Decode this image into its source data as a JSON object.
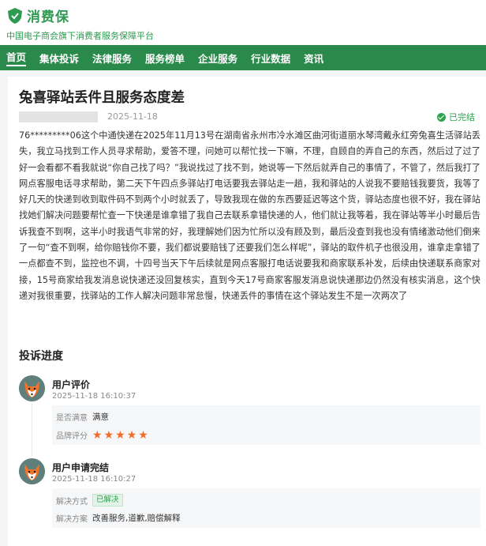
{
  "brand": {
    "name": "消费保",
    "slogan": "中国电子商会旗下消费者服务保障平台",
    "color": "#2e9a52"
  },
  "nav": {
    "items": [
      "首页",
      "集体投诉",
      "法律服务",
      "服务榜单",
      "企业服务",
      "行业数据",
      "资讯"
    ],
    "active_index": 0,
    "background": "#2a8a4b"
  },
  "complaint": {
    "title": "兔喜驿站丢件且服务态度差",
    "date": "2025-11-18",
    "status": "已完结",
    "status_color": "#2fa34e",
    "content": "76*********06这个中通快递在2025年11月13号在湖南省永州市冷水滩区曲河街道丽水琴湾戴永红旁兔喜生活驿站丢失，我立马找到工作人员寻求帮助，爱答不理，问她可以帮忙找一下嘛，不理，自顾自的弄自己的东西，然后过了过了好一会看都不看我就说“你自己找了吗？”我说找过了找不到，她说等一下然后就弄自己的事情了，不管了，然后我打了网点客服电话寻求帮助，第二天下午四点多驿站打电话要我去驿站走一趟，我和驿站的人说我不要赔钱我要货，我等了好几天的快递到收到取件码不到两个小时就丢了，导致我现在做的东西要延迟等这个货，驿站态度也很不好，我在驿站找她们解决问题要帮忙查一下快递是谁拿错了我自己去联系拿错快递的人，他们就让我等着，我在驿站等半小时最后告诉我查不到啊，这半小时我语气非常的好，我理解她们因为忙所以没有顾及到，最后没查到我也没有情绪激动他们倒来了一句“查不到啊，给你赔钱你不要，我们都说要赔钱了还要我们怎么样呢”，驿站的取件机子也很没用，谁拿走拿错了一点都查不到，监控也不调，十四号当天下午后续就是网点客服打电话说要我和商家联系补发，后续由快递联系商家对接，15号商家给我发消息说快递还没回复核实，直到今天17号商家客服发消息说快递那边仍然没有核实消息，这个快递对我很重要，找驿站的工作人解决问题非常怠慢，快递丢件的事情在这个驿站发生不是一次两次了"
  },
  "progress": {
    "title": "投诉进度",
    "steps": [
      {
        "name": "用户评价",
        "time": "2025-11-18 16:10:37",
        "rows": [
          {
            "label": "是否满意",
            "value": "满意"
          },
          {
            "label": "品牌评分",
            "stars": 5,
            "max_stars": 5
          }
        ]
      },
      {
        "name": "用户申请完结",
        "time": "2025-11-18 16:10:27",
        "rows": [
          {
            "label": "解决方式",
            "badge": "已解决"
          },
          {
            "label": "解决方案",
            "value": "改善服务,道歉,赔偿解释"
          }
        ]
      }
    ],
    "star_color": "#f36b25"
  }
}
